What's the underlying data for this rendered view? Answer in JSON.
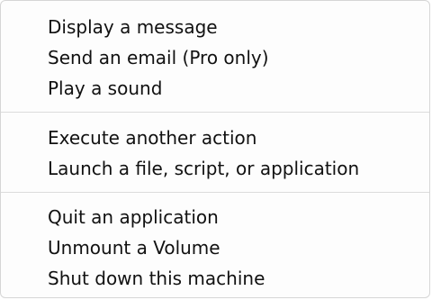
{
  "menu": {
    "groups": [
      {
        "items": [
          {
            "label": "Display a message"
          },
          {
            "label": "Send an email (Pro only)"
          },
          {
            "label": "Play a sound"
          }
        ]
      },
      {
        "items": [
          {
            "label": "Execute another action"
          },
          {
            "label": "Launch a file, script, or application"
          }
        ]
      },
      {
        "items": [
          {
            "label": "Quit an application"
          },
          {
            "label": "Unmount a Volume"
          },
          {
            "label": "Shut down this machine"
          }
        ]
      }
    ]
  }
}
